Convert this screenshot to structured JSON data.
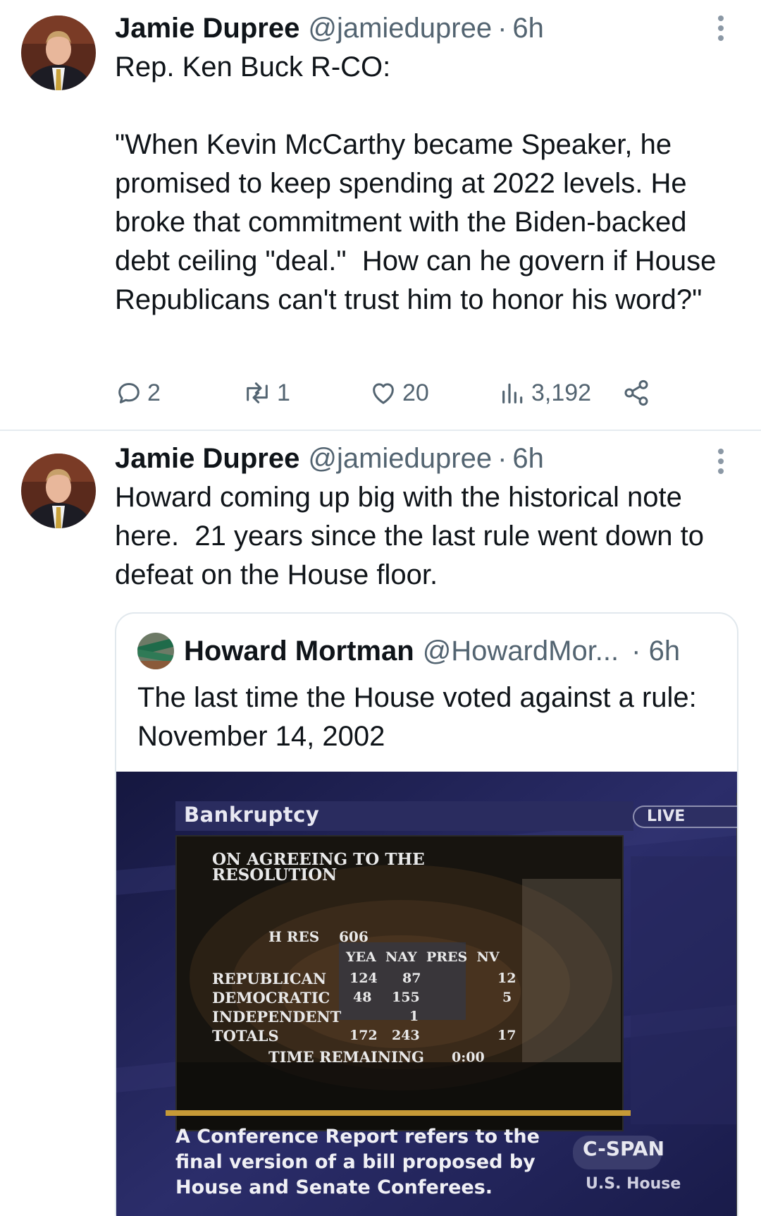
{
  "tweets": [
    {
      "author_name": "Jamie Dupree",
      "handle": "@jamiedupree",
      "separator": "·",
      "time": "6h",
      "text": "Rep. Ken Buck R-CO:\n\n\"When Kevin McCarthy became Speaker, he promised to keep spending at 2022 levels. He broke that commitment with the Biden-backed debt ceiling \"deal.\"  How can he govern if House Republicans can't trust him to honor his word?\"",
      "actions": {
        "reply_count": "2",
        "retweet_count": "1",
        "like_count": "20",
        "view_count": "3,192"
      }
    },
    {
      "author_name": "Jamie Dupree",
      "handle": "@jamiedupree",
      "separator": "·",
      "time": "6h",
      "text": "Howard coming up big with the historical note here.  21 years since the last rule went down to defeat on the House floor.",
      "quote": {
        "author_name": "Howard Mortman",
        "handle": "@HowardMor...",
        "time": "· 6h",
        "text": "The last time the House voted against a rule: November 14, 2002",
        "media": {
          "banner_title": "Bankruptcy",
          "live_label": "LIVE",
          "vote_title": "ON AGREEING TO THE\nRESOLUTION",
          "bill": "H RES    606",
          "columns": "YEA  NAY  PRES  NV",
          "rows": [
            {
              "label": "REPUBLICAN",
              "yea": "124",
              "nay": "87",
              "pres": "",
              "nv": "12"
            },
            {
              "label": "DEMOCRATIC",
              "yea": "48",
              "nay": "155",
              "pres": "",
              "nv": "5"
            },
            {
              "label": "INDEPENDENT",
              "yea": "",
              "nay": "1",
              "pres": "",
              "nv": ""
            },
            {
              "label": "TOTALS",
              "yea": "172",
              "nay": "243",
              "pres": "",
              "nv": "17"
            }
          ],
          "time_remaining_label": "TIME REMAINING",
          "time_remaining_value": "0:00",
          "caption": "A Conference Report refers to the\nfinal version of a bill proposed by\nHouse and Senate Conferees.",
          "network": "C-SPAN",
          "channel": "U.S. House"
        }
      }
    }
  ],
  "icons": {
    "more": "more-vertical-icon",
    "reply": "reply-icon",
    "retweet": "retweet-icon",
    "like": "heart-icon",
    "views": "analytics-icon",
    "share": "share-icon"
  },
  "colors": {
    "text_primary": "#0f1419",
    "text_secondary": "#536471",
    "divider": "#e6ecf0"
  }
}
